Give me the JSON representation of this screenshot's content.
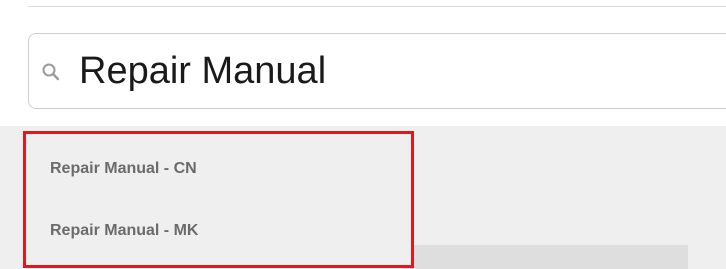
{
  "search": {
    "value": "Repair Manual",
    "icon": "search-icon"
  },
  "suggestions": [
    {
      "label": "Repair Manual - CN"
    },
    {
      "label": "Repair Manual - MK"
    }
  ],
  "colors": {
    "highlight_border": "#e0191e",
    "suggestion_text": "#6b6b6b",
    "panel_background": "#efefef"
  }
}
